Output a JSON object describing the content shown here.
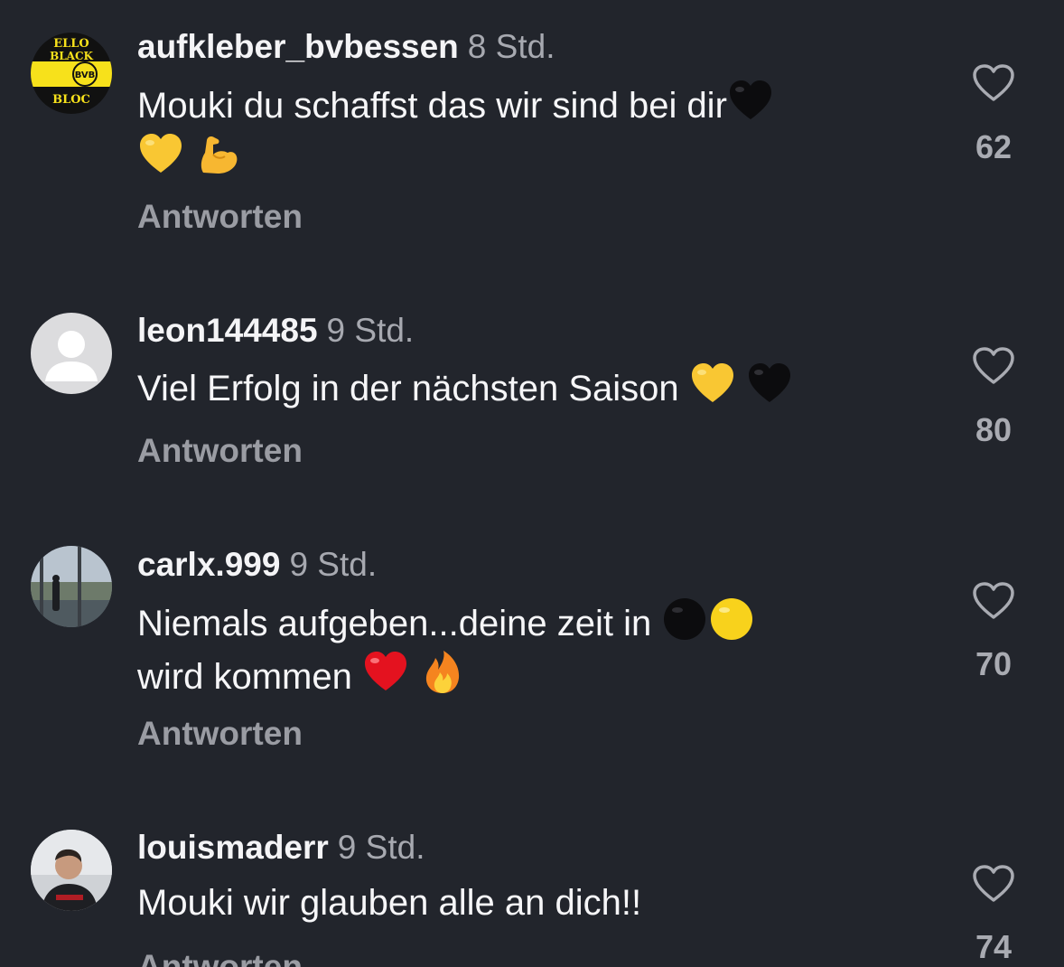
{
  "comments": [
    {
      "username": "aufkleber_bvbessen",
      "time": "8 Std.",
      "text": "Mouki du schaffst das wir sind bei dir",
      "emojis": [
        "black-heart",
        "yellow-heart",
        "flexed-biceps"
      ],
      "reply_label": "Antworten",
      "likes": "62",
      "avatar_text": [
        "ELLO",
        "BLACK",
        "BVB",
        "BLOC"
      ]
    },
    {
      "username": "leon144485",
      "time": "9 Std.",
      "text": "Viel Erfolg in der nächsten Saison",
      "emojis": [
        "yellow-heart",
        "black-heart"
      ],
      "reply_label": "Antworten",
      "likes": "80"
    },
    {
      "username": "carlx.999",
      "time": "9 Std.",
      "text_line1": "Niemals aufgeben...deine zeit in",
      "text_line2": "wird kommen",
      "emojis": [
        "black-circle",
        "yellow-circle",
        "red-heart",
        "fire"
      ],
      "reply_label": "Antworten",
      "likes": "70"
    },
    {
      "username": "louismaderr",
      "time": "9 Std.",
      "text": "Mouki wir glauben alle an dich!!",
      "reply_label": "Antworten",
      "likes": "74"
    }
  ],
  "icons": {
    "like": "heart-outline-icon",
    "default_avatar": "person-silhouette-icon"
  },
  "colors": {
    "background": "#22252c",
    "username": "#f4f4f6",
    "secondary_text": "#a7a9b0",
    "bvb_yellow": "#f7e11b"
  }
}
